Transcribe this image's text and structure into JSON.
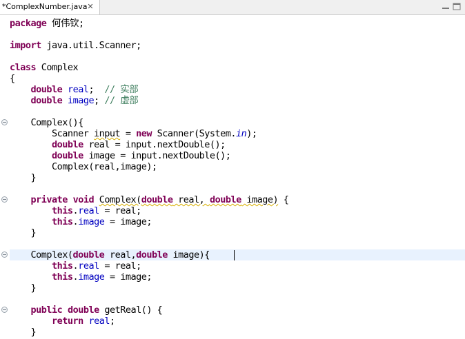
{
  "tab": {
    "title": "*ComplexNumber.java",
    "close_glyph": "✕"
  },
  "code_lines": [
    {
      "tokens": [
        {
          "t": "package",
          "c": "kw"
        },
        {
          "t": " 何伟钦;"
        }
      ]
    },
    {
      "tokens": []
    },
    {
      "tokens": [
        {
          "t": "import",
          "c": "kw"
        },
        {
          "t": " java.util.Scanner;"
        }
      ]
    },
    {
      "tokens": []
    },
    {
      "tokens": [
        {
          "t": "class",
          "c": "kw"
        },
        {
          "t": " Complex"
        }
      ]
    },
    {
      "tokens": [
        {
          "t": "{"
        }
      ]
    },
    {
      "tokens": [
        {
          "t": "    "
        },
        {
          "t": "double",
          "c": "kw"
        },
        {
          "t": " "
        },
        {
          "t": "real",
          "c": "fld"
        },
        {
          "t": ";  "
        },
        {
          "t": "// 实部",
          "c": "cm"
        }
      ]
    },
    {
      "tokens": [
        {
          "t": "    "
        },
        {
          "t": "double",
          "c": "kw"
        },
        {
          "t": " "
        },
        {
          "t": "image",
          "c": "fld"
        },
        {
          "t": "; "
        },
        {
          "t": "// 虚部",
          "c": "cm"
        }
      ]
    },
    {
      "tokens": []
    },
    {
      "tokens": [
        {
          "t": "    Complex(){"
        }
      ]
    },
    {
      "tokens": [
        {
          "t": "        Scanner "
        },
        {
          "t": "input",
          "c": "warn"
        },
        {
          "t": " = "
        },
        {
          "t": "new",
          "c": "kw"
        },
        {
          "t": " Scanner(System."
        },
        {
          "t": "in",
          "c": "st"
        },
        {
          "t": ");"
        }
      ]
    },
    {
      "tokens": [
        {
          "t": "        "
        },
        {
          "t": "double",
          "c": "kw"
        },
        {
          "t": " real = input.nextDouble();"
        }
      ]
    },
    {
      "tokens": [
        {
          "t": "        "
        },
        {
          "t": "double",
          "c": "kw"
        },
        {
          "t": " image = input.nextDouble();"
        }
      ]
    },
    {
      "tokens": [
        {
          "t": "        Complex(real,image);"
        }
      ]
    },
    {
      "tokens": [
        {
          "t": "    }"
        }
      ]
    },
    {
      "tokens": []
    },
    {
      "tokens": [
        {
          "t": "    "
        },
        {
          "t": "private",
          "c": "kw"
        },
        {
          "t": " "
        },
        {
          "t": "void",
          "c": "kw"
        },
        {
          "t": " "
        },
        {
          "t": "Complex(",
          "c": "warn"
        },
        {
          "t": "double",
          "c": "kw warn"
        },
        {
          "t": " real, ",
          "c": "warn"
        },
        {
          "t": "double",
          "c": "kw warn"
        },
        {
          "t": " image)",
          "c": "warn"
        },
        {
          "t": " {"
        }
      ]
    },
    {
      "tokens": [
        {
          "t": "        "
        },
        {
          "t": "this",
          "c": "kw"
        },
        {
          "t": "."
        },
        {
          "t": "real",
          "c": "fld"
        },
        {
          "t": " = real;"
        }
      ]
    },
    {
      "tokens": [
        {
          "t": "        "
        },
        {
          "t": "this",
          "c": "kw"
        },
        {
          "t": "."
        },
        {
          "t": "image",
          "c": "fld"
        },
        {
          "t": " = image;"
        }
      ]
    },
    {
      "tokens": [
        {
          "t": "    }"
        }
      ]
    },
    {
      "tokens": []
    },
    {
      "tokens": [
        {
          "t": "    Complex("
        },
        {
          "t": "double",
          "c": "kw"
        },
        {
          "t": " real,"
        },
        {
          "t": "double",
          "c": "kw"
        },
        {
          "t": " image){ "
        }
      ]
    },
    {
      "tokens": [
        {
          "t": "        "
        },
        {
          "t": "this",
          "c": "kw"
        },
        {
          "t": "."
        },
        {
          "t": "real",
          "c": "fld"
        },
        {
          "t": " = real;"
        }
      ]
    },
    {
      "tokens": [
        {
          "t": "        "
        },
        {
          "t": "this",
          "c": "kw"
        },
        {
          "t": "."
        },
        {
          "t": "image",
          "c": "fld"
        },
        {
          "t": " = image;"
        }
      ]
    },
    {
      "tokens": [
        {
          "t": "    }"
        }
      ]
    },
    {
      "tokens": []
    },
    {
      "tokens": [
        {
          "t": "    "
        },
        {
          "t": "public",
          "c": "kw"
        },
        {
          "t": " "
        },
        {
          "t": "double",
          "c": "kw"
        },
        {
          "t": " getReal() {"
        }
      ]
    },
    {
      "tokens": [
        {
          "t": "        "
        },
        {
          "t": "return",
          "c": "kw"
        },
        {
          "t": " "
        },
        {
          "t": "real",
          "c": "fld"
        },
        {
          "t": ";"
        }
      ]
    },
    {
      "tokens": [
        {
          "t": "    }"
        }
      ]
    }
  ],
  "fold_markers": [
    {
      "line": 10,
      "glyph": "⊖"
    },
    {
      "line": 17,
      "glyph": "⊖"
    },
    {
      "line": 22,
      "glyph": "⊖"
    },
    {
      "line": 27,
      "glyph": "⊖"
    }
  ],
  "current_line": 22
}
